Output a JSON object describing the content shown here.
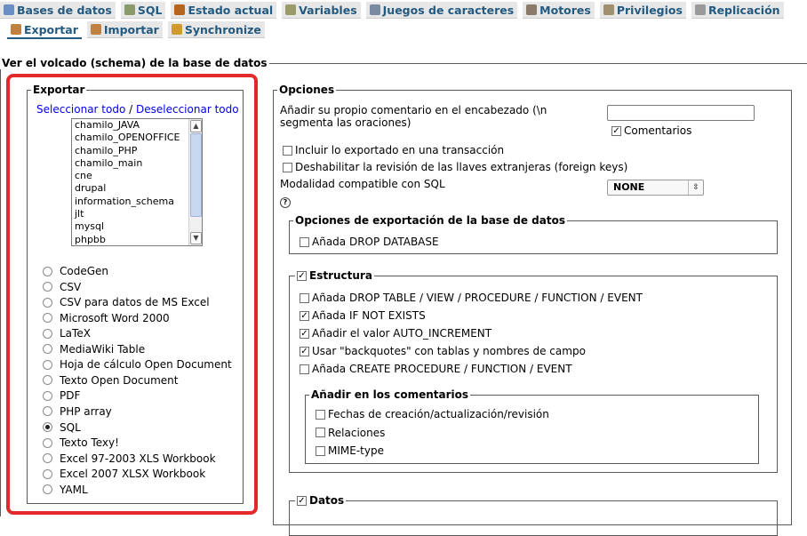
{
  "top_tabs": [
    {
      "label": "Bases de datos",
      "icon": "databases-icon",
      "color": "#6b8fc4"
    },
    {
      "label": "SQL",
      "icon": "sql-icon",
      "color": "#8a9a6a"
    },
    {
      "label": "Estado actual",
      "icon": "status-icon",
      "color": "#b5651d"
    },
    {
      "label": "Variables",
      "icon": "variables-icon",
      "color": "#9a9a6a"
    },
    {
      "label": "Juegos de caracteres",
      "icon": "charsets-icon",
      "color": "#7a8aa0"
    },
    {
      "label": "Motores",
      "icon": "engines-icon",
      "color": "#8a7a6a"
    },
    {
      "label": "Privilegios",
      "icon": "privileges-icon",
      "color": "#a09070"
    },
    {
      "label": "Replicación",
      "icon": "replication-icon",
      "color": "#9a9a9a"
    }
  ],
  "sub_tabs": [
    {
      "label": "Exportar",
      "icon": "export-icon",
      "color": "#c08040",
      "active": true
    },
    {
      "label": "Importar",
      "icon": "import-icon",
      "color": "#c08040",
      "active": false
    },
    {
      "label": "Synchronize",
      "icon": "synchronize-icon",
      "color": "#d09a30",
      "active": false
    }
  ],
  "page_title": "Ver el volcado (schema) de la base de datos",
  "export": {
    "legend": "Exportar",
    "select_all": "Seleccionar todo",
    "separator": "/",
    "deselect_all": "Deseleccionar todo",
    "databases": [
      "chamilo_JAVA",
      "chamilo_OPENOFFICE",
      "chamilo_PHP",
      "chamilo_main",
      "cne",
      "drupal",
      "information_schema",
      "jlt",
      "mysql",
      "phpbb"
    ],
    "formats": [
      "CodeGen",
      "CSV",
      "CSV para datos de MS Excel",
      "Microsoft Word 2000",
      "LaTeX",
      "MediaWiki Table",
      "Hoja de cálculo Open Document",
      "Texto Open Document",
      "PDF",
      "PHP array",
      "SQL",
      "Texto Texy!",
      "Excel 97-2003 XLS Workbook",
      "Excel 2007 XLSX Workbook",
      "YAML"
    ],
    "selected_format": "SQL"
  },
  "options": {
    "legend": "Opciones",
    "comment_label": "Añadir su propio comentario en el encabezado (\\n segmenta las oraciones)",
    "comment_value": "",
    "comentarios_label": "Comentarios",
    "comentarios_checked": true,
    "transaction_label": "Incluir lo exportado en una transacción",
    "transaction_checked": false,
    "foreign_keys_label": "Deshabilitar la revisión de las llaves extranjeras (foreign keys)",
    "foreign_keys_checked": false,
    "compat_label": "Modalidad compatible con SQL",
    "compat_value": "NONE",
    "help_icon": "help-icon",
    "db_options": {
      "legend": "Opciones de exportación de la base de datos",
      "drop_database_label": "Añada DROP DATABASE",
      "drop_database_checked": false
    },
    "structure": {
      "legend": "Estructura",
      "checked": true,
      "items": [
        {
          "label": "Añada DROP TABLE / VIEW / PROCEDURE / FUNCTION / EVENT",
          "checked": false
        },
        {
          "label": "Añada IF NOT EXISTS",
          "checked": true
        },
        {
          "label": "Añadir el valor AUTO_INCREMENT",
          "checked": true
        },
        {
          "label": "Usar \"backquotes\" con tablas y nombres de campo",
          "checked": true
        },
        {
          "label": "Añada CREATE PROCEDURE / FUNCTION / EVENT",
          "checked": false
        }
      ],
      "comments": {
        "legend": "Añadir en los comentarios",
        "items": [
          {
            "label": "Fechas de creación/actualización/revisión",
            "checked": false
          },
          {
            "label": "Relaciones",
            "checked": false
          },
          {
            "label": "MIME-type",
            "checked": false
          }
        ]
      }
    },
    "data": {
      "legend": "Datos",
      "checked": true
    }
  },
  "highlight_color": "#e32a2a"
}
